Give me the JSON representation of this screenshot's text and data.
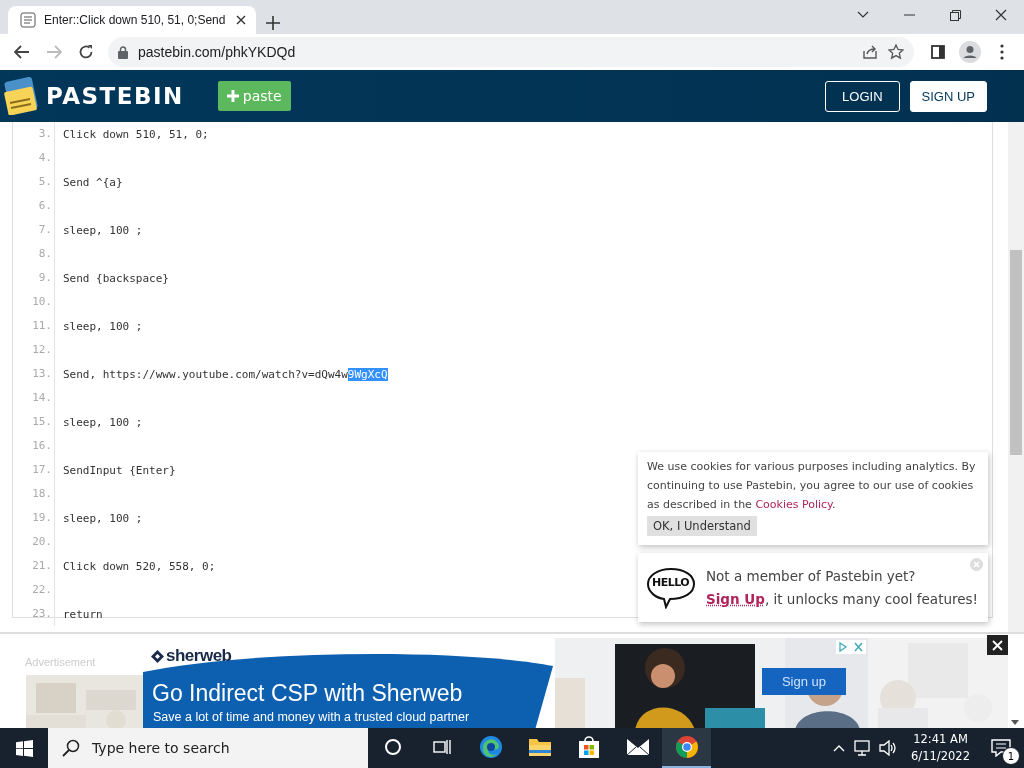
{
  "browser": {
    "tab": {
      "title": "Enter::Click down 510, 51, 0;Send",
      "selected": true
    },
    "url": "pastebin.com/phkYKDQd",
    "forward_disabled": true
  },
  "header": {
    "brand": "PASTEBIN",
    "paste_button": "paste",
    "login": "LOGIN",
    "signup": "SIGN UP"
  },
  "code": {
    "lines": [
      {
        "number": "3.",
        "text": "Click down 510, 51, 0;"
      },
      {
        "number": "4."
      },
      {
        "number": "5.",
        "text": "Send ^{a}"
      },
      {
        "number": "6."
      },
      {
        "number": "7.",
        "text": "sleep, 100 ;"
      },
      {
        "number": "8."
      },
      {
        "number": "9.",
        "text": "Send {backspace}"
      },
      {
        "number": "10."
      },
      {
        "number": "11.",
        "text": "sleep, 100 ;"
      },
      {
        "number": "12."
      },
      {
        "number": "13.",
        "text": "Send, https://www.youtube.com/watch?v=dQw4w",
        "selection": "9WgXcQ"
      },
      {
        "number": "14."
      },
      {
        "number": "15.",
        "text": "sleep, 100 ;"
      },
      {
        "number": "16."
      },
      {
        "number": "17.",
        "text": "SendInput {Enter}"
      },
      {
        "number": "18."
      },
      {
        "number": "19.",
        "text": "sleep, 100 ;"
      },
      {
        "number": "20."
      },
      {
        "number": "21.",
        "text": "Click down 520, 558, 0;"
      },
      {
        "number": "22."
      },
      {
        "number": "23.",
        "text": "return"
      }
    ]
  },
  "cookie_notice": {
    "text": "We use cookies for various purposes including analytics. By continuing to use Pastebin, you agree to our use of cookies as described in the ",
    "link": "Cookies Policy",
    "text_end": ".",
    "button": "OK, I Understand"
  },
  "member_prompt": {
    "badge": "HELLO",
    "title": "Not a member of Pastebin yet?",
    "link": "Sign Up",
    "text": ", it unlocks many cool features!"
  },
  "ad": {
    "label": "Advertisement",
    "brand": "sherweb",
    "headline": "Go Indirect CSP with Sherweb",
    "subline": "Save a lot of time and money with a trusted cloud partner",
    "button": "Sign up"
  },
  "taskbar": {
    "search_placeholder": "Type here to search",
    "apps": [
      {
        "kind": "cortana",
        "selected": false
      },
      {
        "kind": "taskview",
        "selected": false
      },
      {
        "kind": "edge",
        "selected": false
      },
      {
        "kind": "folder",
        "selected": false
      },
      {
        "kind": "store",
        "selected": false
      },
      {
        "kind": "mail",
        "selected": false
      },
      {
        "kind": "chrome",
        "selected": true
      }
    ],
    "time": "12:41 AM",
    "date": "6/11/2022",
    "notifications": "1"
  }
}
